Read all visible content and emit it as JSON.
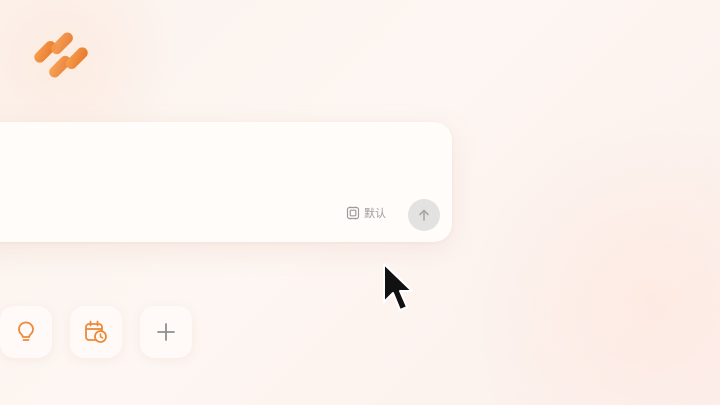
{
  "app": {
    "logo_icon": "orange-tiles-logo",
    "accent_color": "#ec8a3a"
  },
  "composer": {
    "input_value": "",
    "model_label": "默认",
    "model_icon": "model-chip-icon",
    "send_icon": "arrow-up-icon"
  },
  "quick_tools": [
    {
      "icon": "lightbulb-icon"
    },
    {
      "icon": "calendar-clock-icon"
    },
    {
      "icon": "plus-icon"
    }
  ]
}
